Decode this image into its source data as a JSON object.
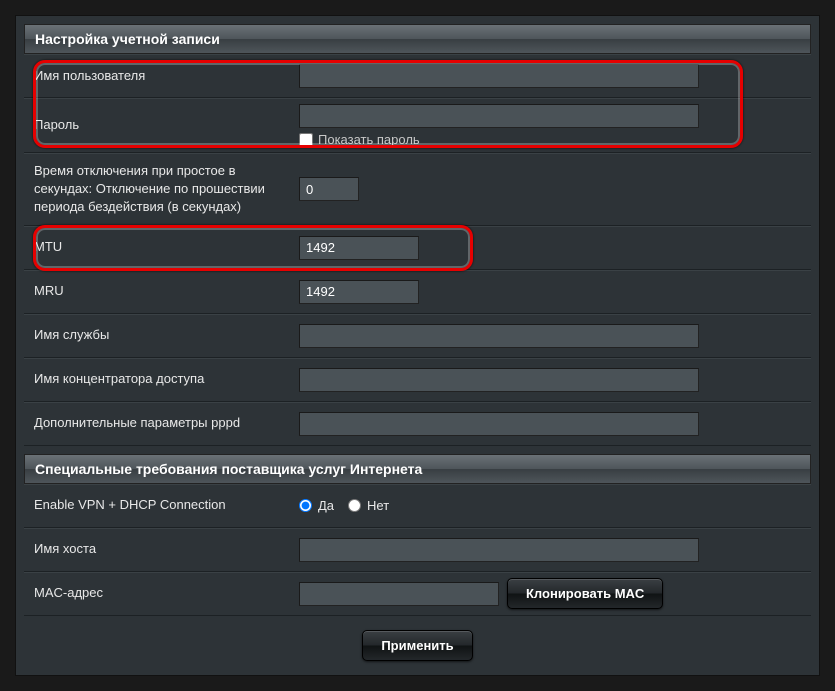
{
  "section1": {
    "title": "Настройка учетной записи",
    "username_label": "Имя пользователя",
    "username_value": "",
    "password_label": "Пароль",
    "password_value": "",
    "show_password_label": "Показать пароль",
    "idle_label": "Время отключения при простое в секундах: Отключение по прошествии периода бездействия (в секундах)",
    "idle_value": "0",
    "mtu_label": "MTU",
    "mtu_value": "1492",
    "mru_label": "MRU",
    "mru_value": "1492",
    "service_label": "Имя службы",
    "service_value": "",
    "concentrator_label": "Имя концентратора доступа",
    "concentrator_value": "",
    "pppd_label": "Дополнительные параметры pppd",
    "pppd_value": ""
  },
  "section2": {
    "title": "Специальные требования поставщика услуг Интернета",
    "vpn_label": "Enable VPN + DHCP Connection",
    "yes_label": "Да",
    "no_label": "Нет",
    "hostname_label": "Имя хоста",
    "hostname_value": "",
    "mac_label": "MAC-адрес",
    "mac_value": "",
    "clone_mac_btn": "Клонировать MAC"
  },
  "apply_btn": "Применить"
}
